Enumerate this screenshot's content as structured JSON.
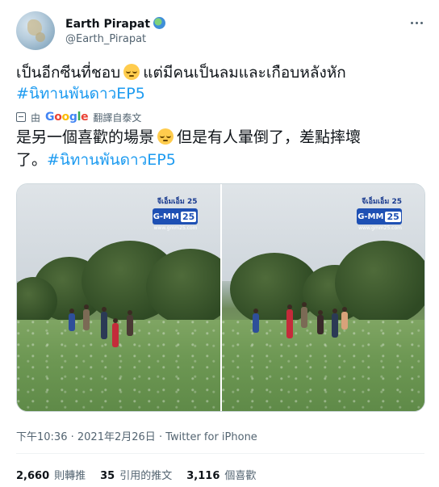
{
  "author": {
    "name": "Earth Pirapat",
    "handle": "@Earth_Pirapat"
  },
  "tweet": {
    "original_part1": "เป็นอีกซีนที่ชอบ",
    "original_part2": "แต่มีคนเป็นลมและเกือบหลังหัก",
    "original_hashtag": "#นิทานพันดาวEP5",
    "translate_prefix": "由",
    "translate_provider": "Google",
    "translate_suffix": "翻譯自泰文",
    "translated_part1": "是另一個喜歡的場景",
    "translated_part2": "但是有人暈倒了，差點摔壞",
    "translated_part3": "了。",
    "translated_hashtag": "#นิทานพันดาวEP5"
  },
  "media": {
    "channel_name": "จีเอ็มเอ็ม 25",
    "channel_logo": "G-MM",
    "channel_number": "25",
    "channel_url": "www.gmm25.com"
  },
  "timestamp": {
    "time": "下午10:36",
    "date": "2021年2月26日",
    "separator": "·",
    "source": "Twitter for iPhone"
  },
  "stats": {
    "retweets_count": "2,660",
    "retweets_label": "則轉推",
    "quotes_count": "35",
    "quotes_label": "引用的推文",
    "likes_count": "3,116",
    "likes_label": "個喜歡"
  },
  "colors": {
    "accent": "#1d9bf0",
    "secondary_text": "#536471",
    "primary_text": "#0f1419"
  },
  "icons": [
    "avatar-globe-icon",
    "verified-globe-emoji",
    "more-options-icon",
    "rolling-eyes-emoji",
    "translate-icon"
  ]
}
